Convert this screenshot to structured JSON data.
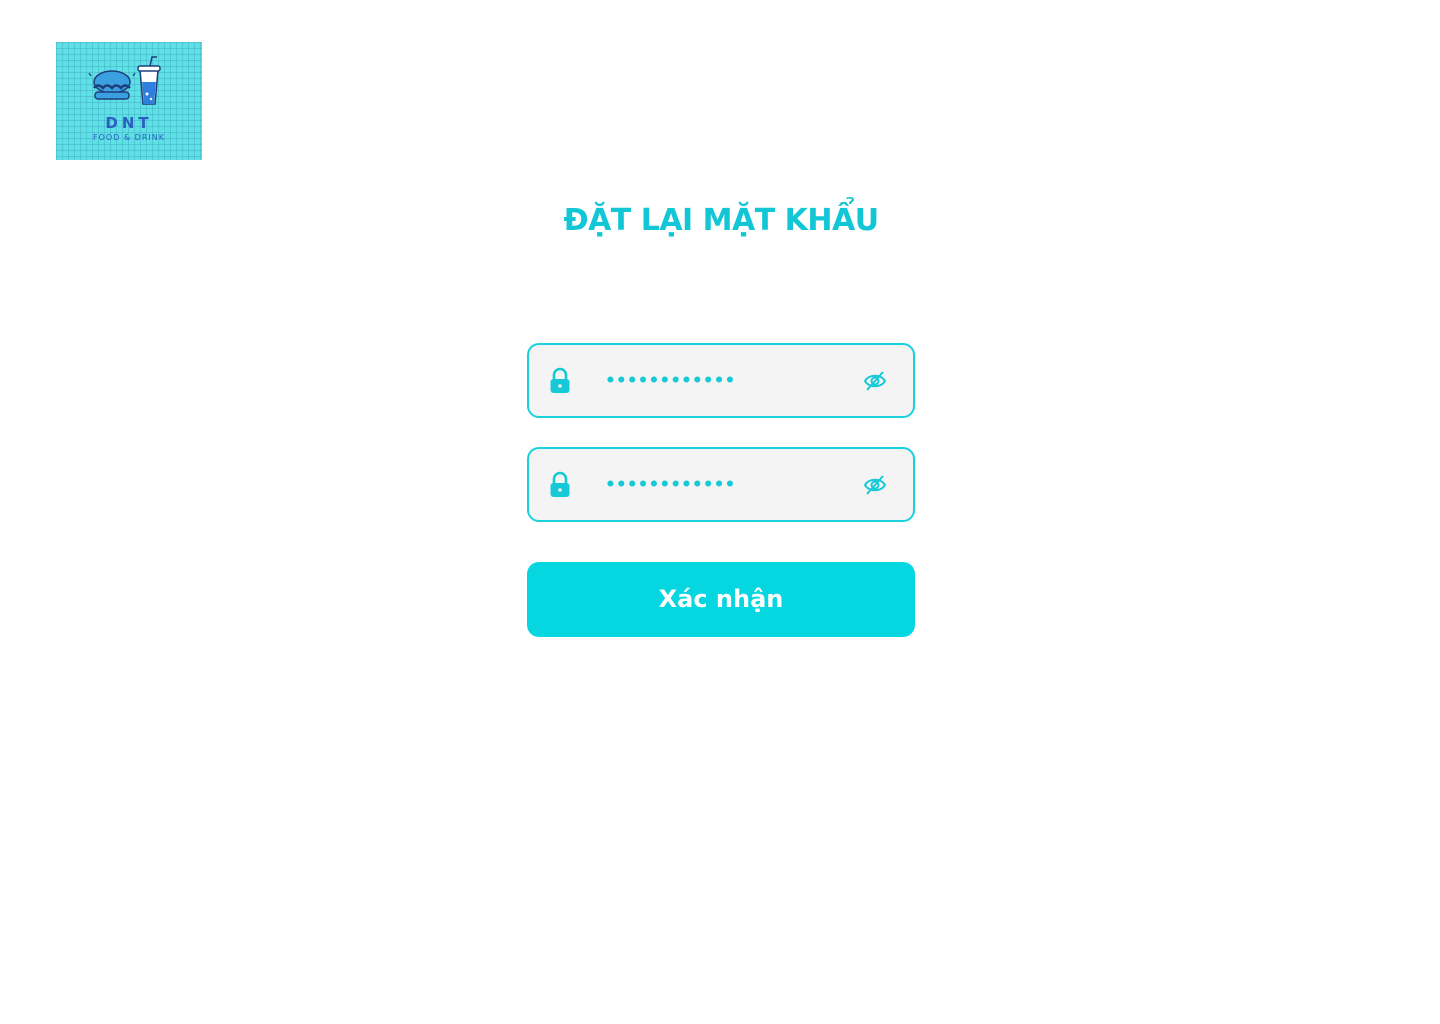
{
  "logo": {
    "name": "DNT",
    "tagline": "FOOD & DRINK",
    "background_color": "#5fe0e6",
    "text_color": "#2a5fc0"
  },
  "page": {
    "title": "ĐẶT LẠI MẶT KHẨU",
    "accent_color": "#12c6d6"
  },
  "fields": [
    {
      "value": "••••••••••••",
      "type": "password",
      "leading_icon": "lock-icon",
      "trailing_icon": "eye-off-icon"
    },
    {
      "value": "••••••••••••",
      "type": "password",
      "leading_icon": "lock-icon",
      "trailing_icon": "eye-off-icon"
    }
  ],
  "submit": {
    "label": "Xác nhận",
    "background_color": "#06d6e0"
  }
}
